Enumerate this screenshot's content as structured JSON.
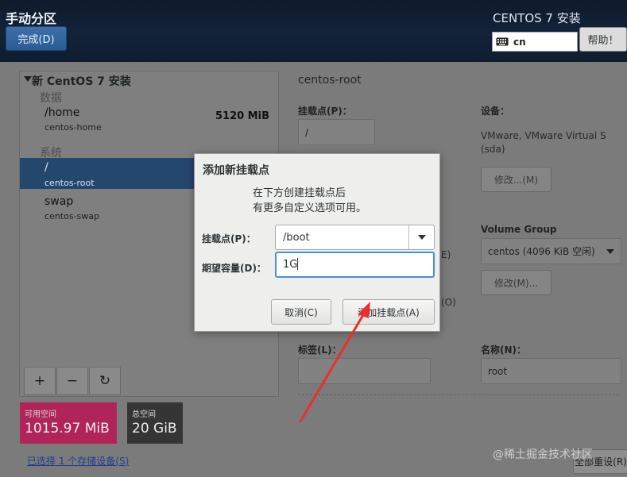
{
  "header": {
    "title": "手动分区",
    "done_button": "完成(D)",
    "subtitle": "CENTOS 7 安装",
    "keyboard_layout": "cn",
    "help_button": "帮助！"
  },
  "left_panel": {
    "tree_title": "新 CentOS 7 安装",
    "groups": {
      "data_label": "数据",
      "system_label": "系统"
    },
    "mounts": [
      {
        "mount": "/home",
        "device": "centos-home",
        "size": "5120 MiB"
      },
      {
        "mount": "/",
        "device": "centos-root",
        "size": ""
      },
      {
        "mount": "swap",
        "device": "centos-swap",
        "size": ""
      }
    ],
    "toolbar": {
      "add": "+",
      "remove": "−",
      "refresh": "↻"
    },
    "available_space": {
      "label": "可用空间",
      "value": "1015.97 MiB"
    },
    "total_space": {
      "label": "总空间",
      "value": "20 GiB"
    },
    "storage_link": "已选择 1 个存储设备(S)"
  },
  "right_panel": {
    "title": "centos-root",
    "mount_point_label": "挂载点(P)：",
    "mount_point_value": "/",
    "device_label": "设备：",
    "device_value": "VMware, VMware Virtual S (sda)",
    "modify_button": "修改...(M)",
    "volume_group_label": "Volume Group",
    "volume_group_value": "centos  (4096 KiB 空闲)",
    "vg_modify_button": "修改(M)...",
    "partial_e": "E)",
    "partial_o": "(O)",
    "tag_label": "标签(L)：",
    "name_label": "名称(N)：",
    "name_value": "root",
    "reset_button": "全部重设(R)"
  },
  "dialog": {
    "title": "添加新挂载点",
    "description": "在下方创建挂载点后\n有更多自定义选项可用。",
    "mount_point_label": "挂载点(P)：",
    "mount_point_value": "/boot",
    "capacity_label": "期望容量(D)：",
    "capacity_value": "1G",
    "cancel_button": "取消(C)",
    "add_button": "添加挂载点(A)"
  },
  "watermark": "@稀土掘金技术社区",
  "colors": {
    "header_bg": "#122238",
    "selected_row": "#24476d",
    "available_space": "#b0245a",
    "total_space": "#353535",
    "annotation_arrow": "#e8302c",
    "input_focus": "#4a90d9"
  }
}
